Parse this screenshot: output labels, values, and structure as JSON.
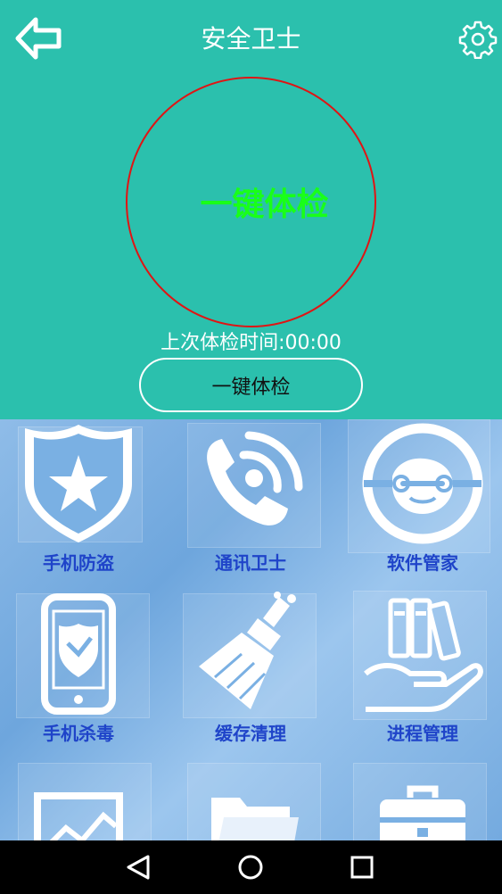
{
  "header": {
    "title": "安全卫士",
    "back_icon": "back-arrow-icon",
    "settings_icon": "gear-icon",
    "background": "#2bc0ad"
  },
  "scan": {
    "circle_label": "一键体检",
    "circle_color": "#e01414",
    "label_color": "#19ff19",
    "last_check_text": "上次体检时间:00:00",
    "button_label": "一键体检"
  },
  "features": [
    {
      "label": "手机防盗",
      "icon": "shield-star-icon"
    },
    {
      "label": "通讯卫士",
      "icon": "phone-signal-icon"
    },
    {
      "label": "软件管家",
      "icon": "wrench-icon"
    },
    {
      "label": "手机杀毒",
      "icon": "phone-shield-icon"
    },
    {
      "label": "缓存清理",
      "icon": "broom-icon"
    },
    {
      "label": "进程管理",
      "icon": "hand-books-icon"
    },
    {
      "label": "",
      "icon": "chart-icon"
    },
    {
      "label": "",
      "icon": "folder-icon"
    },
    {
      "label": "",
      "icon": "toolbox-icon"
    }
  ],
  "label_color": "#1f44c9",
  "navbar": {
    "back_icon": "nav-back-icon",
    "home_icon": "nav-home-icon",
    "recents_icon": "nav-recents-icon"
  }
}
